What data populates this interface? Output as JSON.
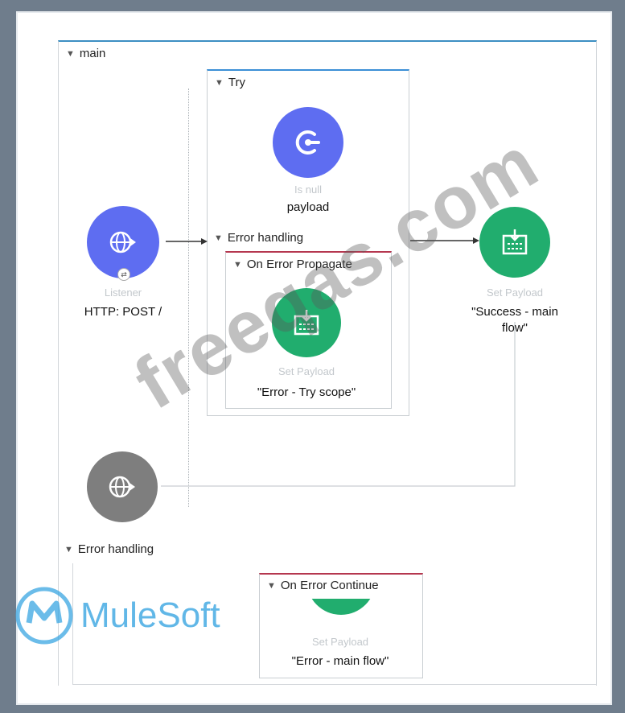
{
  "main_flow": {
    "label": "main"
  },
  "try_scope": {
    "label": "Try",
    "is_null": {
      "faded_label": "Is null",
      "label": "payload"
    },
    "error_handling_label": "Error handling",
    "on_error_propagate": {
      "label": "On Error Propagate",
      "set_payload": {
        "faded_label": "Set Payload",
        "label": "\"Error - Try scope\""
      }
    }
  },
  "listener": {
    "faded_label": "Listener",
    "label": "HTTP: POST /"
  },
  "set_payload_success": {
    "faded_label": "Set Payload",
    "label_line1": "\"Success - main",
    "label_line2": "flow\""
  },
  "main_error_handling": {
    "label": "Error handling",
    "on_error_continue": {
      "label": "On Error Continue",
      "set_payload": {
        "faded_label": "Set Payload",
        "label": "\"Error - main flow\""
      }
    }
  },
  "logo": {
    "text": "MuleSoft"
  },
  "watermark": {
    "text": "freeqas.com"
  },
  "colors": {
    "blue_node": "#5e6df1",
    "green_node": "#21ad6e",
    "gray_node": "#7e7e7e",
    "propagate_border": "#b5374f",
    "try_border": "#3b8fd6",
    "mulesoft_blue": "#3aa6e2"
  }
}
